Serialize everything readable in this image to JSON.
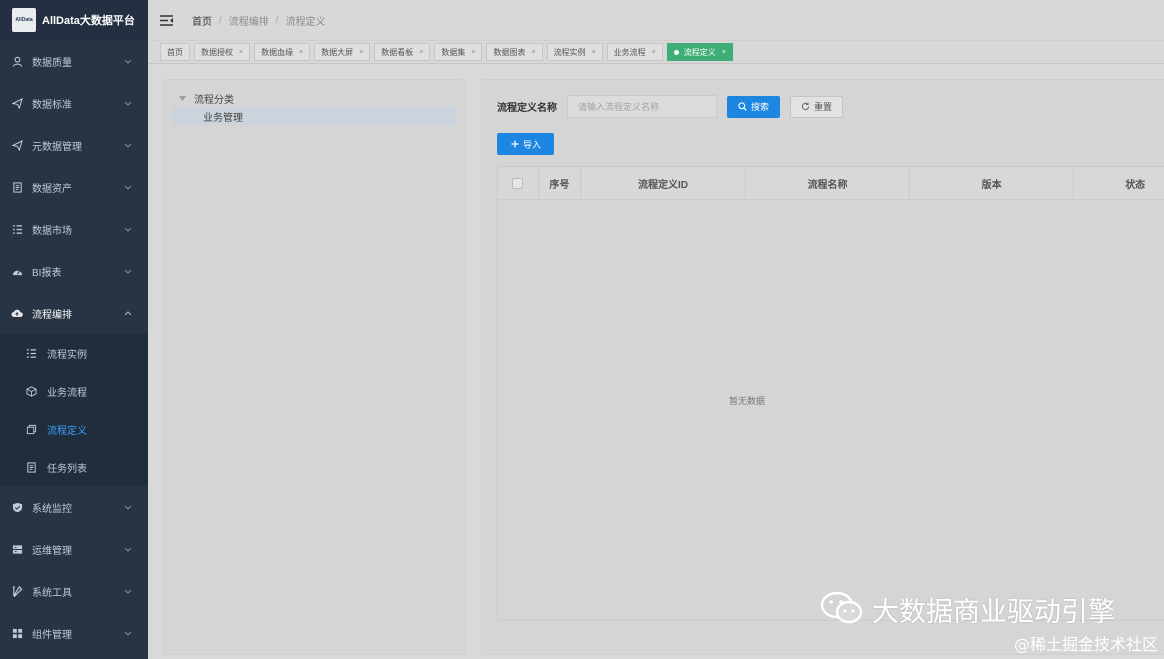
{
  "logo": {
    "mark": "AllData",
    "title": "AllData大数据平台"
  },
  "sidebar": {
    "items": [
      {
        "label": "数据质量",
        "icon": "quality-icon"
      },
      {
        "label": "数据标准",
        "icon": "send-icon"
      },
      {
        "label": "元数据管理",
        "icon": "send-icon"
      },
      {
        "label": "数据资产",
        "icon": "document-icon"
      },
      {
        "label": "数据市场",
        "icon": "list-icon"
      },
      {
        "label": "BI报表",
        "icon": "dashboard-icon"
      },
      {
        "label": "流程编排",
        "icon": "cloud-icon",
        "open": true
      }
    ],
    "submenu": [
      {
        "label": "流程实例",
        "icon": "list-icon"
      },
      {
        "label": "业务流程",
        "icon": "cube-icon"
      },
      {
        "label": "流程定义",
        "icon": "copy-icon",
        "active": true
      },
      {
        "label": "任务列表",
        "icon": "document-icon"
      }
    ],
    "items_after": [
      {
        "label": "系统监控",
        "icon": "shield-icon"
      },
      {
        "label": "运维管理",
        "icon": "server-icon"
      },
      {
        "label": "系统工具",
        "icon": "tools-icon"
      },
      {
        "label": "组件管理",
        "icon": "grid-icon"
      }
    ]
  },
  "breadcrumb": [
    "首页",
    "流程编排",
    "流程定义"
  ],
  "tags": [
    {
      "label": "首页",
      "closable": false
    },
    {
      "label": "数据授权",
      "closable": true
    },
    {
      "label": "数据血缘",
      "closable": true
    },
    {
      "label": "数据大屏",
      "closable": true
    },
    {
      "label": "数据看板",
      "closable": true
    },
    {
      "label": "数据集",
      "closable": true
    },
    {
      "label": "数据图表",
      "closable": true
    },
    {
      "label": "流程实例",
      "closable": true
    },
    {
      "label": "业务流程",
      "closable": true
    },
    {
      "label": "流程定义",
      "closable": true,
      "active": true
    }
  ],
  "tree": {
    "root": "流程分类",
    "children": [
      "业务管理"
    ]
  },
  "search": {
    "label": "流程定义名称",
    "placeholder": "请输入流程定义名称",
    "search_button": "搜索",
    "reset_button": "重置"
  },
  "toolbar": {
    "import_label": "导入"
  },
  "table": {
    "columns": [
      "序号",
      "流程定义ID",
      "流程名称",
      "版本",
      "状态"
    ],
    "empty_text": "暂无数据"
  },
  "watermark": {
    "text": "大数据商业驱动引擎",
    "sub": "@稀土掘金技术社区"
  },
  "colors": {
    "sidebar_bg": "#283443",
    "primary": "#1d86e0",
    "active_tag": "#3fae76",
    "active_menu": "#409eff"
  }
}
